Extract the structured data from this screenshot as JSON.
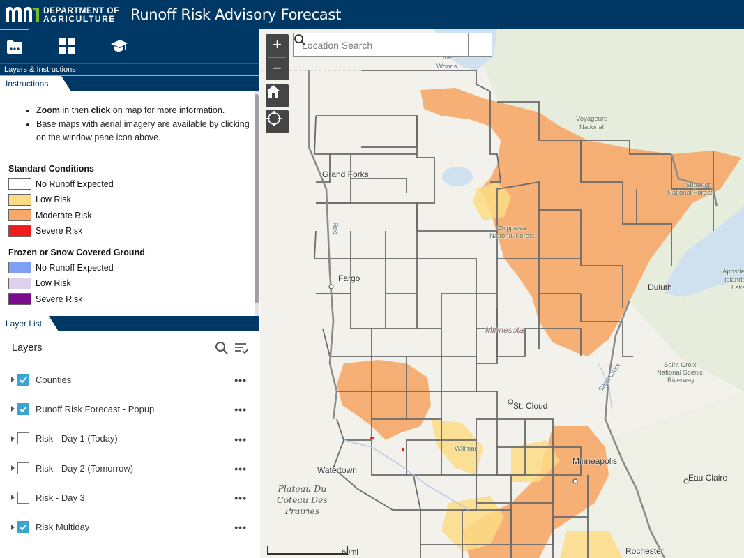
{
  "header": {
    "logo_line1": "DEPARTMENT OF",
    "logo_line2": "AGRICULTURE",
    "title": "Runoff Risk Advisory Forecast"
  },
  "toolbar": {
    "icons": [
      "layers-folder-icon",
      "basemap-grid-icon",
      "instructions-cap-icon"
    ],
    "label": "Layers & Instructions"
  },
  "instructions": {
    "tab_label": "Instructions",
    "bullet1_a": "Zoom",
    "bullet1_b": " in then ",
    "bullet1_c": "click",
    "bullet1_d": " on map for more information.",
    "bullet2": "Base maps with aerial imagery are available by clicking on the window pane icon above.",
    "standard_title": "Standard Conditions",
    "standard": [
      {
        "label": "No Runoff Expected",
        "color": "#ffffff"
      },
      {
        "label": "Low Risk",
        "color": "#fddc85"
      },
      {
        "label": "Moderate Risk",
        "color": "#f6a96a"
      },
      {
        "label": "Severe Risk",
        "color": "#ee1c1c"
      }
    ],
    "frozen_title": "Frozen or Snow Covered Ground",
    "frozen": [
      {
        "label": "No Runoff Expected",
        "color": "#7f9ff2"
      },
      {
        "label": "Low Risk",
        "color": "#dcd2ec"
      },
      {
        "label": "Severe Risk",
        "color": "#7a0b8c"
      }
    ]
  },
  "layer_list": {
    "tab_label": "Layer List",
    "heading": "Layers",
    "items": [
      {
        "label": "Counties",
        "checked": true
      },
      {
        "label": "Runoff Risk Forecast - Popup",
        "checked": true
      },
      {
        "label": "Risk - Day 1 (Today)",
        "checked": false
      },
      {
        "label": "Risk - Day 2 (Tomorrow)",
        "checked": false
      },
      {
        "label": "Risk - Day 3",
        "checked": false
      },
      {
        "label": "Risk Multiday",
        "checked": true
      }
    ],
    "more_label": "•••"
  },
  "map": {
    "search_placeholder": "Location Search",
    "zoom_in": "+",
    "zoom_out": "−",
    "scale_label": "60mi",
    "places": {
      "lake_woods_1": "the",
      "lake_woods_2": "Woods",
      "voyageurs_1": "Voyageurs",
      "voyageurs_2": "National",
      "grand_forks": "Grand Forks",
      "superior_1": "Superior",
      "superior_2": "National Forest",
      "chippewa_1": "Chippewa",
      "chippewa_2": "National Forest",
      "fargo": "Fargo",
      "duluth": "Duluth",
      "apostle_1": "Apostle",
      "apostle_2": "Islands",
      "apostle_3": "Lake",
      "minnesota": "Minnesota",
      "st_croix_1": "Saint Croix",
      "st_croix_2": "National Scenic",
      "st_croix_3": "Riverway",
      "st_croix_river": "Saint Croix",
      "st_cloud": "St. Cloud",
      "willmar": "Willmar",
      "watertown": "Watertown",
      "minneapolis": "Minneapolis",
      "eau_claire": "Eau Claire",
      "plateau_1": "Plateau Du",
      "plateau_2": "Coteau Des",
      "plateau_3": "Prairies",
      "rochester": "Rochester",
      "red_river": "Red"
    }
  }
}
